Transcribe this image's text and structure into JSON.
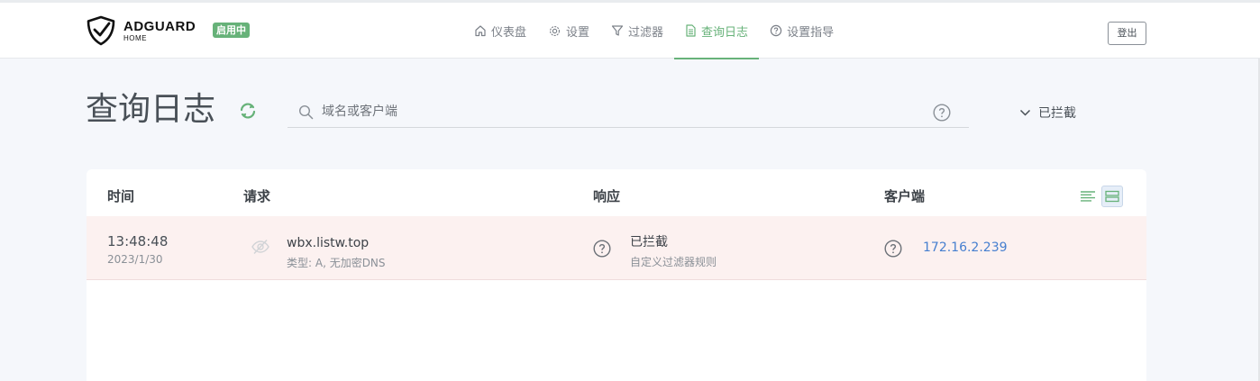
{
  "header": {
    "logo_title": "ADGUARD",
    "logo_sub": "HOME",
    "status_badge": "启用中",
    "nav": [
      {
        "label": "仪表盘",
        "icon": "home-icon"
      },
      {
        "label": "设置",
        "icon": "gear-icon"
      },
      {
        "label": "过滤器",
        "icon": "filter-icon"
      },
      {
        "label": "查询日志",
        "icon": "document-icon",
        "active": true
      },
      {
        "label": "设置指导",
        "icon": "help-circle-icon"
      }
    ],
    "logout_label": "登出"
  },
  "page": {
    "title": "查询日志",
    "search_placeholder": "域名或客户端",
    "filter_label": "已拦截"
  },
  "table": {
    "columns": [
      "时间",
      "请求",
      "响应",
      "客户端"
    ],
    "rows": [
      {
        "time": "13:48:48",
        "date": "2023/1/30",
        "domain": "wbx.listw.top",
        "request_detail": "类型: A, 无加密DNS",
        "response": "已拦截",
        "response_detail": "自定义过滤器规则",
        "client": "172.16.2.239"
      }
    ]
  },
  "colors": {
    "accent": "#67b279",
    "blocked_row_bg": "#fcf1f0",
    "link": "#467fcf"
  }
}
